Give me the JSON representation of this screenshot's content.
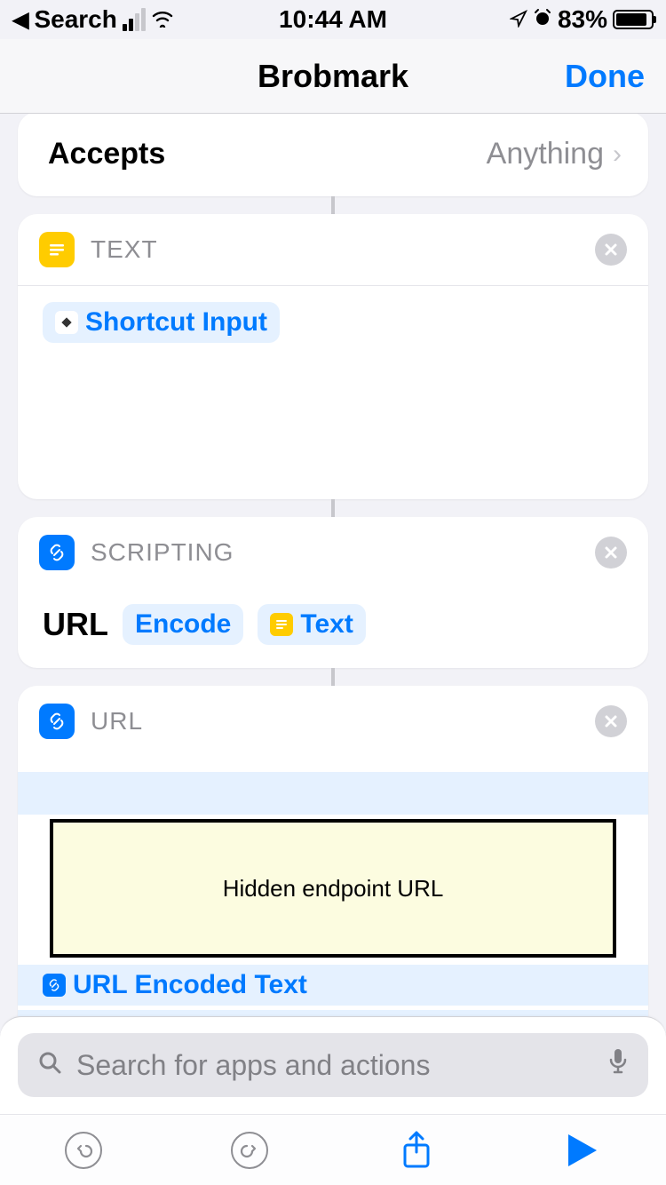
{
  "status": {
    "back_label": "Search",
    "time": "10:44 AM",
    "battery_pct": "83%"
  },
  "nav": {
    "title": "Brobmark",
    "done": "Done"
  },
  "accepts": {
    "label": "Accepts",
    "value": "Anything"
  },
  "action_text": {
    "title": "TEXT",
    "token": "Shortcut Input"
  },
  "action_scripting": {
    "title": "SCRIPTING",
    "label": "URL",
    "param1": "Encode",
    "param2": "Text"
  },
  "action_url": {
    "title": "URL",
    "hidden_label": "Hidden endpoint URL",
    "token": "URL Encoded Text"
  },
  "search": {
    "placeholder": "Search for apps and actions"
  }
}
